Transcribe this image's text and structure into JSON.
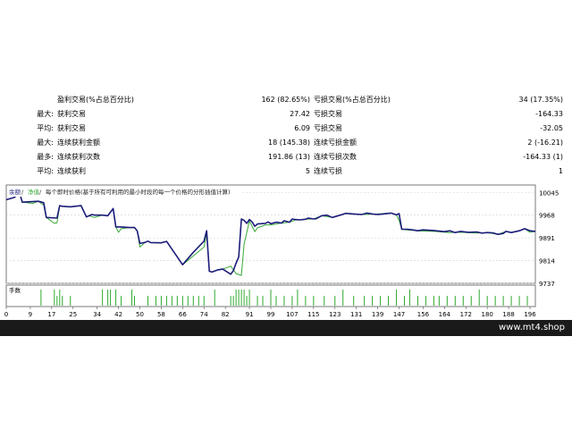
{
  "stats": {
    "rows": [
      [
        "",
        "盈利交易(%占总百分比)",
        "162 (82.65%)",
        "亏损交易(%占总百分比)",
        "34 (17.35%)"
      ],
      [
        "最大:",
        "获利交易",
        "27.42",
        "亏损交易",
        "-164.33"
      ],
      [
        "平均:",
        "获利交易",
        "6.09",
        "亏损交易",
        "-32.05"
      ],
      [
        "最大:",
        "连续获利金额",
        "18 (145.38)",
        "连续亏损金额",
        "2 (-16.21)"
      ],
      [
        "最多:",
        "连续获利次数",
        "191.86 (13)",
        "连续亏损次数",
        "-164.33 (1)"
      ],
      [
        "平均:",
        "连续获利",
        "5",
        "连续亏损",
        "1"
      ]
    ]
  },
  "chart_data": {
    "type": "line",
    "legend": {
      "balance_label": "余额",
      "equity_label": "净值",
      "note": "每个即时价格(基于所有可利用的最小时段的每一个价格的分形插值计算)"
    },
    "colors": {
      "balance": "#1c1c7a",
      "equity": "#37a837",
      "volume": "#2eaa2e",
      "grid": "#d0d0d0"
    },
    "ylim": [
      9737,
      10070
    ],
    "y_ticks": [
      10045,
      9968,
      9891,
      9814,
      9737
    ],
    "xlim": [
      0,
      198
    ],
    "x_ticks": [
      0,
      9,
      17,
      25,
      34,
      42,
      50,
      58,
      66,
      74,
      82,
      91,
      99,
      107,
      115,
      123,
      131,
      139,
      147,
      156,
      164,
      172,
      180,
      188,
      196
    ],
    "volume_label": "手数",
    "series": [
      {
        "key": "balance",
        "name": "余额",
        "x": [
          0,
          3,
          5,
          6,
          12,
          14,
          15,
          19,
          20,
          21,
          24,
          28,
          30,
          31,
          32,
          33,
          36,
          38,
          40,
          41,
          42,
          43,
          46,
          47,
          48,
          49,
          50,
          52,
          53,
          54,
          58,
          60,
          66,
          70,
          74,
          75,
          76,
          77,
          79,
          81,
          84,
          85,
          86,
          87,
          88,
          89,
          90,
          91,
          92,
          93,
          94,
          97,
          98,
          99,
          101,
          103,
          104,
          106,
          107,
          108,
          110,
          112,
          113,
          115,
          116,
          118,
          120,
          122,
          125,
          127,
          130,
          133,
          135,
          137,
          139,
          141,
          144,
          146,
          147,
          148,
          150,
          152,
          154,
          156,
          160,
          164,
          166,
          168,
          170,
          173,
          176,
          178,
          180,
          182,
          184,
          186,
          187,
          189,
          192,
          194,
          196,
          198
        ],
        "y": [
          10020,
          10028,
          10044,
          10012,
          10015,
          10010,
          9960,
          9958,
          10000,
          9998,
          9996,
          10000,
          9962,
          9966,
          9970,
          9968,
          9968,
          9966,
          9990,
          9928,
          9928,
          9928,
          9926,
          9926,
          9926,
          9915,
          9872,
          9876,
          9880,
          9875,
          9874,
          9879,
          9800,
          9842,
          9880,
          9915,
          9778,
          9775,
          9782,
          9785,
          9768,
          9780,
          9805,
          9826,
          9955,
          9950,
          9940,
          9953,
          9945,
          9930,
          9938,
          9940,
          9945,
          9939,
          9944,
          9941,
          9949,
          9944,
          9955,
          9953,
          9952,
          9954,
          9958,
          9955,
          9956,
          9966,
          9968,
          9960,
          9968,
          9974,
          9972,
          9970,
          9975,
          9972,
          9970,
          9972,
          9975,
          9969,
          9973,
          9920,
          9920,
          9918,
          9915,
          9918,
          9916,
          9912,
          9915,
          9909,
          9913,
          9910,
          9911,
          9907,
          9909,
          9908,
          9903,
          9906,
          9913,
          9909,
          9915,
          9922,
          9915,
          9913
        ]
      },
      {
        "key": "equity",
        "name": "净值",
        "x": [
          0,
          3,
          5,
          6,
          10,
          12,
          14,
          15,
          18,
          19,
          20,
          21,
          24,
          28,
          30,
          31,
          33,
          36,
          38,
          40,
          41,
          42,
          43,
          46,
          48,
          49,
          50,
          52,
          53,
          54,
          58,
          60,
          66,
          74,
          75,
          76,
          77,
          79,
          81,
          84,
          86,
          88,
          89,
          91,
          93,
          94,
          97,
          99,
          103,
          106,
          108,
          110,
          112,
          115,
          118,
          122,
          127,
          133,
          139,
          144,
          146,
          147,
          148,
          150,
          154,
          160,
          166,
          170,
          176,
          180,
          184,
          187,
          189,
          192,
          194,
          196,
          198
        ],
        "y": [
          10020,
          10028,
          10044,
          10012,
          10008,
          10015,
          10002,
          9960,
          9940,
          9942,
          10000,
          9998,
          9996,
          10000,
          9962,
          9966,
          9960,
          9968,
          9966,
          9990,
          9928,
          9910,
          9922,
          9926,
          9926,
          9915,
          9860,
          9876,
          9880,
          9875,
          9874,
          9879,
          9800,
          9860,
          9904,
          9778,
          9775,
          9782,
          9785,
          9795,
          9770,
          9764,
          9870,
          9948,
          9912,
          9925,
          9935,
          9935,
          9941,
          9944,
          9951,
          9952,
          9954,
          9955,
          9966,
          9960,
          9974,
          9970,
          9972,
          9975,
          9969,
          9950,
          9920,
          9918,
          9915,
          9913,
          9909,
          9910,
          9907,
          9909,
          9903,
          9913,
          9909,
          9915,
          9922,
          9910,
          9913
        ]
      }
    ],
    "volume_x": [
      13,
      18,
      19,
      20,
      21,
      24,
      36,
      38,
      39,
      41,
      43,
      47,
      48,
      53,
      56,
      58,
      60,
      62,
      64,
      66,
      68,
      70,
      72,
      74,
      78,
      84,
      85,
      86,
      87,
      88,
      89,
      90,
      91,
      94,
      96,
      99,
      101,
      104,
      107,
      109,
      112,
      115,
      119,
      123,
      126,
      130,
      134,
      137,
      140,
      143,
      146,
      149,
      151,
      154,
      157,
      160,
      162,
      165,
      168,
      171,
      174,
      177,
      180,
      183,
      186,
      189,
      192,
      195
    ],
    "volume_y": [
      2,
      2,
      1,
      2,
      1,
      1,
      2,
      2,
      2,
      2,
      1,
      2,
      1,
      1,
      1,
      1,
      1,
      1,
      1,
      1,
      1,
      1,
      1,
      1,
      2,
      1,
      1,
      2,
      2,
      2,
      2,
      1,
      2,
      1,
      1,
      2,
      1,
      1,
      1,
      2,
      1,
      1,
      1,
      1,
      2,
      1,
      1,
      1,
      1,
      1,
      2,
      1,
      2,
      1,
      1,
      1,
      1,
      1,
      1,
      1,
      1,
      2,
      1,
      1,
      1,
      1,
      1,
      1
    ]
  },
  "footer": {
    "site": "www.mt4.shop"
  }
}
